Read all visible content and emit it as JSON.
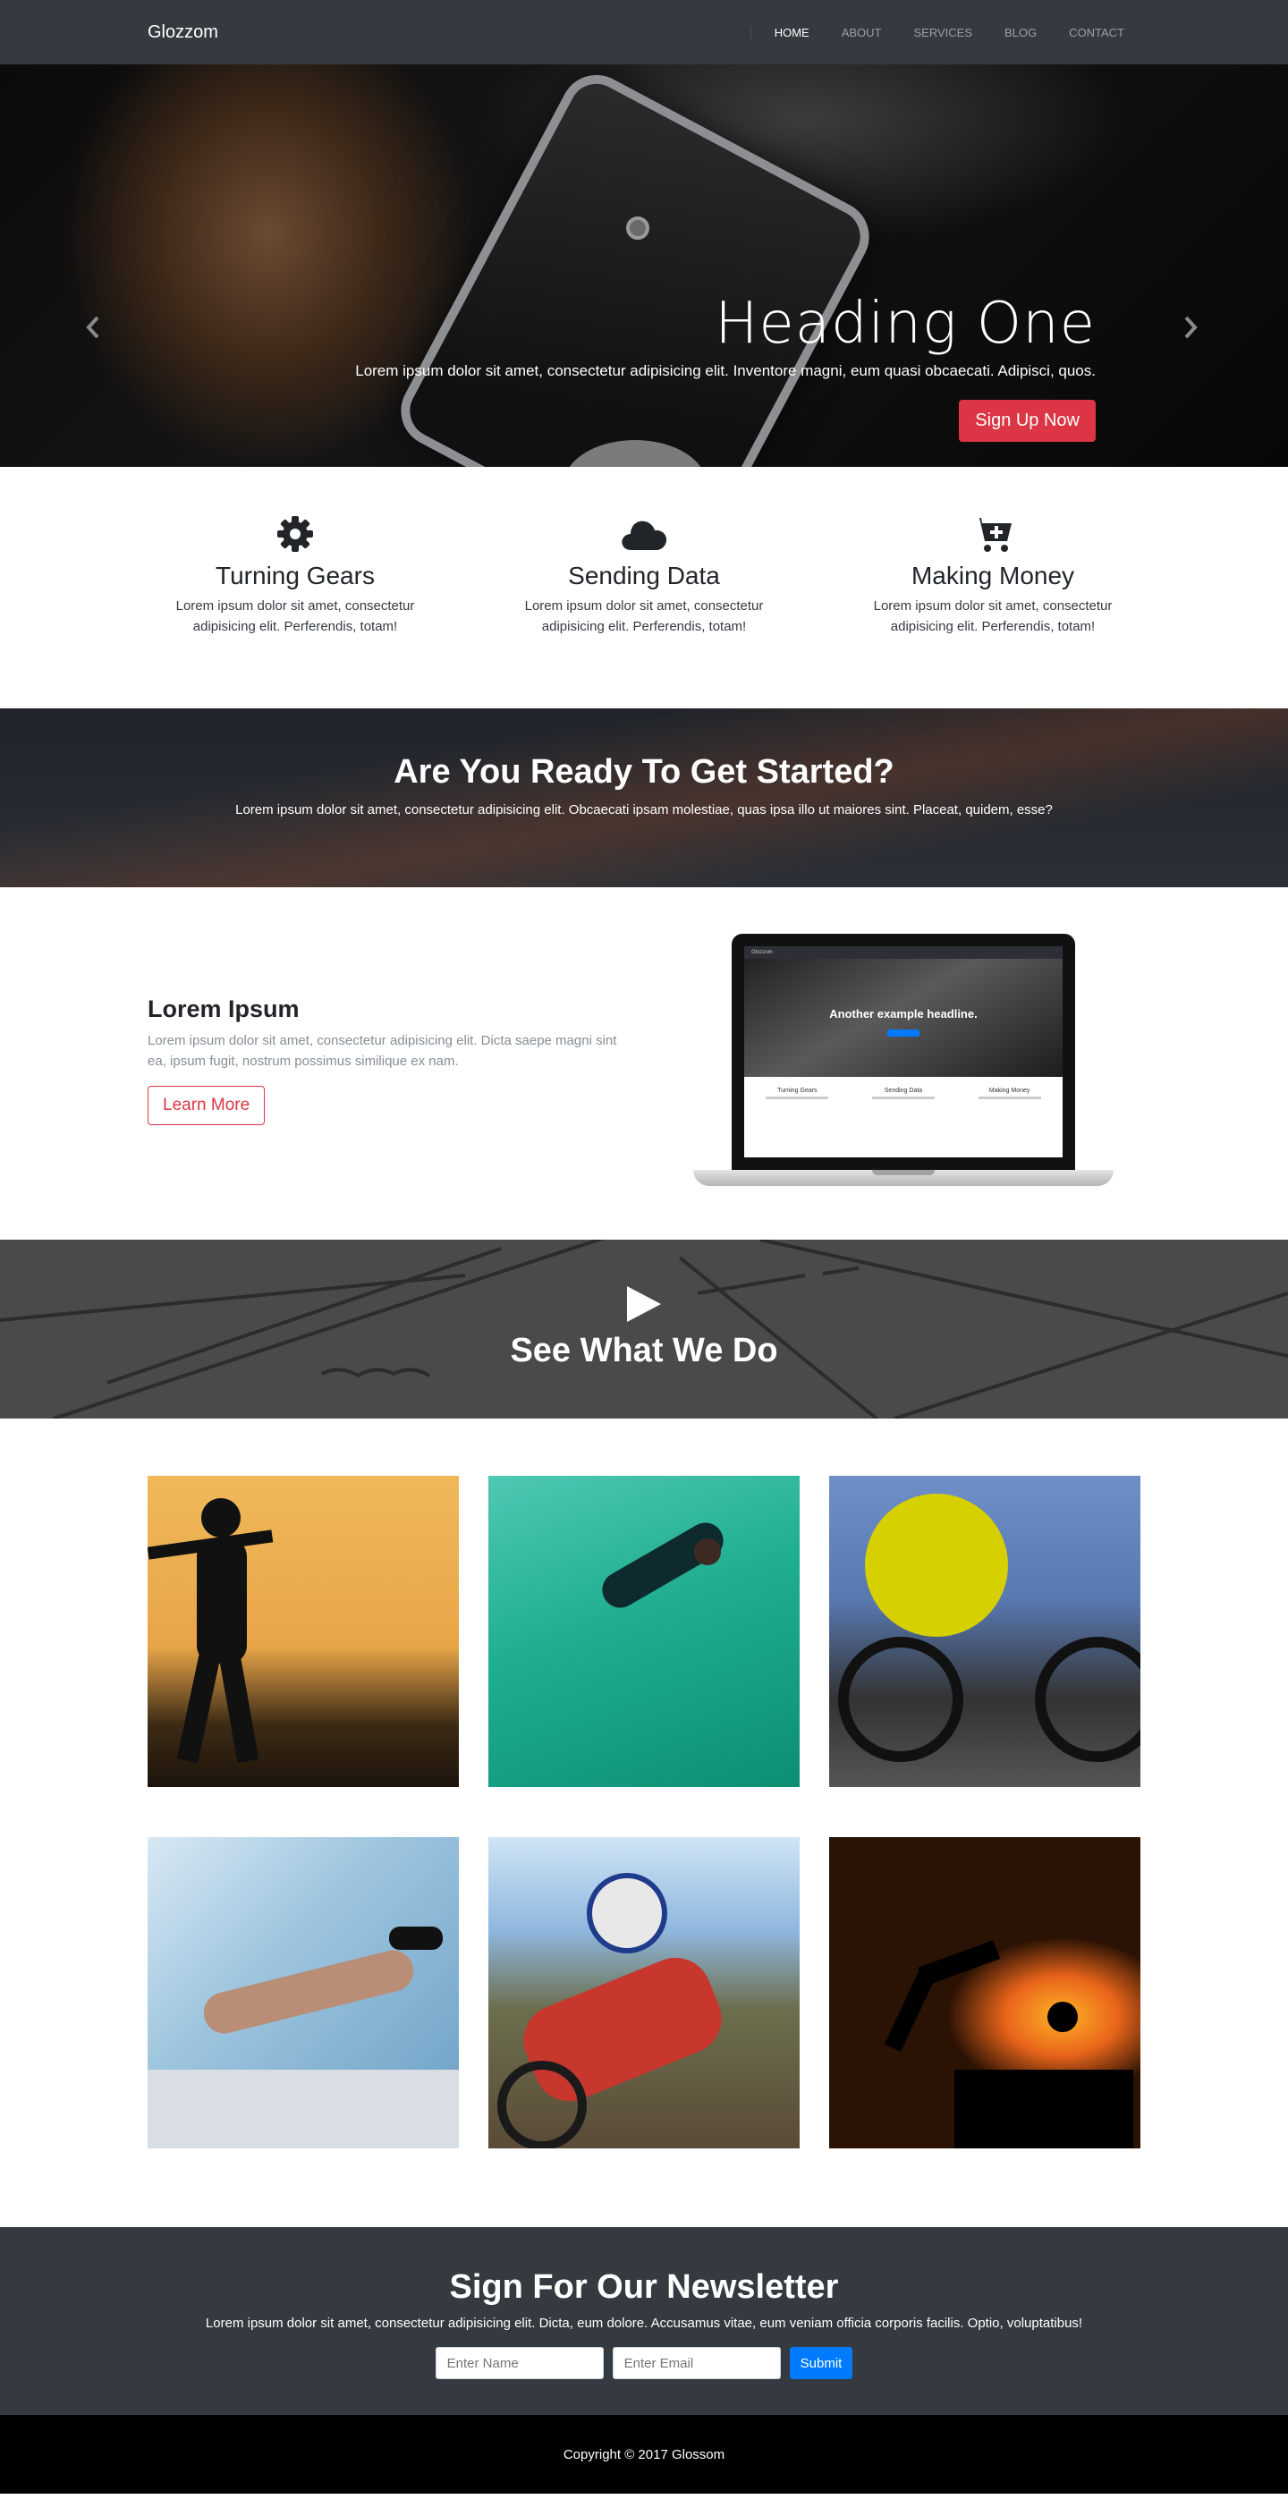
{
  "navbar": {
    "brand": "Glozzom",
    "links": [
      {
        "label": "Home",
        "active": true
      },
      {
        "label": "About"
      },
      {
        "label": "Services"
      },
      {
        "label": "Blog"
      },
      {
        "label": "Contact"
      }
    ]
  },
  "hero": {
    "title": "Heading One",
    "text": "Lorem ipsum dolor sit amet, consectetur adipisicing elit. Inventore magni, eum quasi obcaecati. Adipisci, quos.",
    "button": "Sign Up Now",
    "prev_icon": "chevron-left-icon",
    "next_icon": "chevron-right-icon",
    "active_slide": 1,
    "slide_count": 2
  },
  "features": [
    {
      "icon": "gear-icon",
      "title": "Turning Gears",
      "text": "Lorem ipsum dolor sit amet, consectetur adipisicing elit. Perferendis, totam!"
    },
    {
      "icon": "cloud-icon",
      "title": "Sending Data",
      "text": "Lorem ipsum dolor sit amet, consectetur adipisicing elit. Perferendis, totam!"
    },
    {
      "icon": "cart-plus-icon",
      "title": "Making Money",
      "text": "Lorem ipsum dolor sit amet, consectetur adipisicing elit. Perferendis, totam!"
    }
  ],
  "cta": {
    "title": "Are You Ready To Get Started?",
    "text": "Lorem ipsum dolor sit amet, consectetur adipisicing elit. Obcaecati ipsam molestiae, quas ipsa illo ut maiores sint. Placeat, quidem, esse?"
  },
  "about": {
    "title": "Lorem Ipsum",
    "text": "Lorem ipsum dolor sit amet, consectetur adipisicing elit. Dicta saepe magni sint ea, ipsum fugit, nostrum possimus similique ex nam.",
    "button": "Learn More",
    "laptop": {
      "brand": "Glozzom",
      "headline": "Another example headline.",
      "features": [
        "Turning Gears",
        "Sending Data",
        "Making Money"
      ]
    }
  },
  "video": {
    "title": "See What We Do",
    "icon": "play-icon"
  },
  "gallery": {
    "images": [
      "baseball-batter",
      "bodyboarder",
      "cyclist",
      "swimmer",
      "motocross-rider",
      "sunset-kick"
    ]
  },
  "newsletter": {
    "title": "Sign For Our Newsletter",
    "text": "Lorem ipsum dolor sit amet, consectetur adipisicing elit. Dicta, eum dolore. Accusamus vitae, eum veniam officia corporis facilis. Optio, voluptatibus!",
    "name_placeholder": "Enter Name",
    "email_placeholder": "Enter Email",
    "submit": "Submit"
  },
  "footer": {
    "copyright": "Copyright © 2017 Glossom"
  },
  "colors": {
    "dark": "#343a40",
    "danger": "#dc3545",
    "primary": "#007bff",
    "muted": "#868e96"
  }
}
